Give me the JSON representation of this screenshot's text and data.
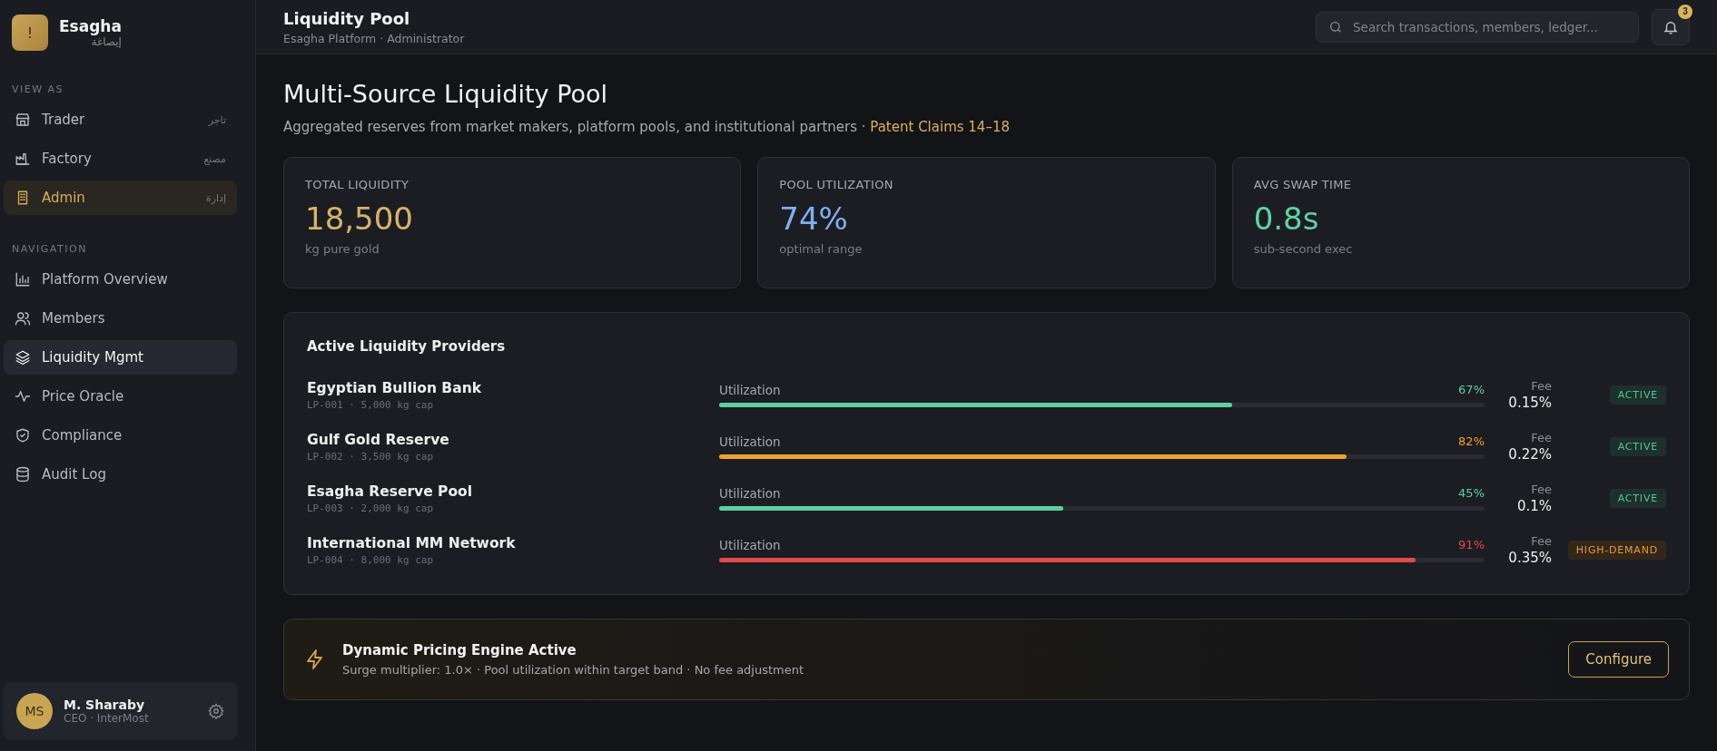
{
  "brand": {
    "logo": "!",
    "name": "Esagha",
    "subtitle": "إيصاغة"
  },
  "view_as": {
    "heading": "VIEW AS",
    "items": [
      {
        "label": "Trader",
        "arabic": "تاجر",
        "selected": false
      },
      {
        "label": "Factory",
        "arabic": "مصنع",
        "selected": false
      },
      {
        "label": "Admin",
        "arabic": "إدارة",
        "selected": true
      }
    ]
  },
  "navigation": {
    "heading": "NAVIGATION",
    "items": [
      {
        "label": "Platform Overview",
        "selected": false
      },
      {
        "label": "Members",
        "selected": false
      },
      {
        "label": "Liquidity Mgmt",
        "selected": true
      },
      {
        "label": "Price Oracle",
        "selected": false
      },
      {
        "label": "Compliance",
        "selected": false
      },
      {
        "label": "Audit Log",
        "selected": false
      }
    ]
  },
  "user": {
    "initials": "MS",
    "name": "M. Sharaby",
    "role": "CEO · InterMost"
  },
  "header": {
    "title": "Liquidity Pool",
    "subtitle": "Esagha Platform · Administrator",
    "search": {
      "placeholder": "Search transactions, members, ledger..."
    },
    "notifications": "3"
  },
  "page": {
    "title": "Multi-Source Liquidity Pool",
    "description": "Aggregated reserves from market makers, platform pools, and institutional partners ·",
    "link": "Patent Claims 14–18"
  },
  "stats": [
    {
      "label": "TOTAL LIQUIDITY",
      "value": "18,500",
      "note": "kg pure gold",
      "color": "#d4b36a"
    },
    {
      "label": "POOL UTILIZATION",
      "value": "74%",
      "note": "optimal range",
      "color": "#7fb1ef"
    },
    {
      "label": "AVG SWAP TIME",
      "value": "0.8s",
      "note": "sub-second exec",
      "color": "#5fd1a6"
    }
  ],
  "providers": {
    "title": "Active Liquidity Providers",
    "items": [
      {
        "name": "Egyptian Bullion Bank",
        "meta": "LP-001 · 5,000 kg cap",
        "bar_label": "Utilization",
        "level": 0.67,
        "reading": "67%",
        "color": "#5ecfa3",
        "fee_label": "Fee",
        "fee": "0.15%",
        "status": "ACTIVE",
        "kind": "active"
      },
      {
        "name": "Gulf Gold Reserve",
        "meta": "LP-002 · 3,500 kg cap",
        "bar_label": "Utilization",
        "level": 0.82,
        "reading": "82%",
        "color": "#eea22a",
        "fee_label": "Fee",
        "fee": "0.22%",
        "status": "ACTIVE",
        "kind": "active"
      },
      {
        "name": "Esagha Reserve Pool",
        "meta": "LP-003 · 2,000 kg cap",
        "bar_label": "Utilization",
        "level": 0.45,
        "reading": "45%",
        "color": "#5ecfa3",
        "fee_label": "Fee",
        "fee": "0.1%",
        "status": "ACTIVE",
        "kind": "active"
      },
      {
        "name": "International MM Network",
        "meta": "LP-004 · 8,000 kg cap",
        "bar_label": "Utilization",
        "level": 0.91,
        "reading": "91%",
        "color": "#e04b4b",
        "fee_label": "Fee",
        "fee": "0.35%",
        "status": "HIGH-DEMAND",
        "kind": "high-demand"
      }
    ]
  },
  "engine": {
    "title": "Dynamic Pricing Engine Active",
    "description": "Surge multiplier: 1.0× · Pool utilization within target band · No fee adjustment",
    "button": "Configure"
  }
}
